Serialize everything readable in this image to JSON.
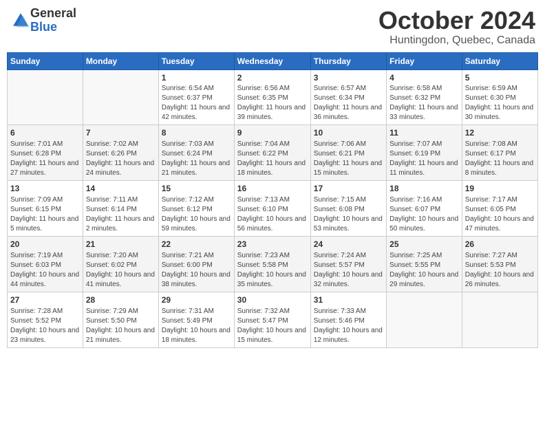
{
  "logo": {
    "general": "General",
    "blue": "Blue",
    "icon_color": "#2a6dc0"
  },
  "title": "October 2024",
  "location": "Huntingdon, Quebec, Canada",
  "days_of_week": [
    "Sunday",
    "Monday",
    "Tuesday",
    "Wednesday",
    "Thursday",
    "Friday",
    "Saturday"
  ],
  "weeks": [
    [
      {
        "day": "",
        "info": ""
      },
      {
        "day": "",
        "info": ""
      },
      {
        "day": "1",
        "info": "Sunrise: 6:54 AM\nSunset: 6:37 PM\nDaylight: 11 hours and 42 minutes."
      },
      {
        "day": "2",
        "info": "Sunrise: 6:56 AM\nSunset: 6:35 PM\nDaylight: 11 hours and 39 minutes."
      },
      {
        "day": "3",
        "info": "Sunrise: 6:57 AM\nSunset: 6:34 PM\nDaylight: 11 hours and 36 minutes."
      },
      {
        "day": "4",
        "info": "Sunrise: 6:58 AM\nSunset: 6:32 PM\nDaylight: 11 hours and 33 minutes."
      },
      {
        "day": "5",
        "info": "Sunrise: 6:59 AM\nSunset: 6:30 PM\nDaylight: 11 hours and 30 minutes."
      }
    ],
    [
      {
        "day": "6",
        "info": "Sunrise: 7:01 AM\nSunset: 6:28 PM\nDaylight: 11 hours and 27 minutes."
      },
      {
        "day": "7",
        "info": "Sunrise: 7:02 AM\nSunset: 6:26 PM\nDaylight: 11 hours and 24 minutes."
      },
      {
        "day": "8",
        "info": "Sunrise: 7:03 AM\nSunset: 6:24 PM\nDaylight: 11 hours and 21 minutes."
      },
      {
        "day": "9",
        "info": "Sunrise: 7:04 AM\nSunset: 6:22 PM\nDaylight: 11 hours and 18 minutes."
      },
      {
        "day": "10",
        "info": "Sunrise: 7:06 AM\nSunset: 6:21 PM\nDaylight: 11 hours and 15 minutes."
      },
      {
        "day": "11",
        "info": "Sunrise: 7:07 AM\nSunset: 6:19 PM\nDaylight: 11 hours and 11 minutes."
      },
      {
        "day": "12",
        "info": "Sunrise: 7:08 AM\nSunset: 6:17 PM\nDaylight: 11 hours and 8 minutes."
      }
    ],
    [
      {
        "day": "13",
        "info": "Sunrise: 7:09 AM\nSunset: 6:15 PM\nDaylight: 11 hours and 5 minutes."
      },
      {
        "day": "14",
        "info": "Sunrise: 7:11 AM\nSunset: 6:14 PM\nDaylight: 11 hours and 2 minutes."
      },
      {
        "day": "15",
        "info": "Sunrise: 7:12 AM\nSunset: 6:12 PM\nDaylight: 10 hours and 59 minutes."
      },
      {
        "day": "16",
        "info": "Sunrise: 7:13 AM\nSunset: 6:10 PM\nDaylight: 10 hours and 56 minutes."
      },
      {
        "day": "17",
        "info": "Sunrise: 7:15 AM\nSunset: 6:08 PM\nDaylight: 10 hours and 53 minutes."
      },
      {
        "day": "18",
        "info": "Sunrise: 7:16 AM\nSunset: 6:07 PM\nDaylight: 10 hours and 50 minutes."
      },
      {
        "day": "19",
        "info": "Sunrise: 7:17 AM\nSunset: 6:05 PM\nDaylight: 10 hours and 47 minutes."
      }
    ],
    [
      {
        "day": "20",
        "info": "Sunrise: 7:19 AM\nSunset: 6:03 PM\nDaylight: 10 hours and 44 minutes."
      },
      {
        "day": "21",
        "info": "Sunrise: 7:20 AM\nSunset: 6:02 PM\nDaylight: 10 hours and 41 minutes."
      },
      {
        "day": "22",
        "info": "Sunrise: 7:21 AM\nSunset: 6:00 PM\nDaylight: 10 hours and 38 minutes."
      },
      {
        "day": "23",
        "info": "Sunrise: 7:23 AM\nSunset: 5:58 PM\nDaylight: 10 hours and 35 minutes."
      },
      {
        "day": "24",
        "info": "Sunrise: 7:24 AM\nSunset: 5:57 PM\nDaylight: 10 hours and 32 minutes."
      },
      {
        "day": "25",
        "info": "Sunrise: 7:25 AM\nSunset: 5:55 PM\nDaylight: 10 hours and 29 minutes."
      },
      {
        "day": "26",
        "info": "Sunrise: 7:27 AM\nSunset: 5:53 PM\nDaylight: 10 hours and 26 minutes."
      }
    ],
    [
      {
        "day": "27",
        "info": "Sunrise: 7:28 AM\nSunset: 5:52 PM\nDaylight: 10 hours and 23 minutes."
      },
      {
        "day": "28",
        "info": "Sunrise: 7:29 AM\nSunset: 5:50 PM\nDaylight: 10 hours and 21 minutes."
      },
      {
        "day": "29",
        "info": "Sunrise: 7:31 AM\nSunset: 5:49 PM\nDaylight: 10 hours and 18 minutes."
      },
      {
        "day": "30",
        "info": "Sunrise: 7:32 AM\nSunset: 5:47 PM\nDaylight: 10 hours and 15 minutes."
      },
      {
        "day": "31",
        "info": "Sunrise: 7:33 AM\nSunset: 5:46 PM\nDaylight: 10 hours and 12 minutes."
      },
      {
        "day": "",
        "info": ""
      },
      {
        "day": "",
        "info": ""
      }
    ]
  ]
}
